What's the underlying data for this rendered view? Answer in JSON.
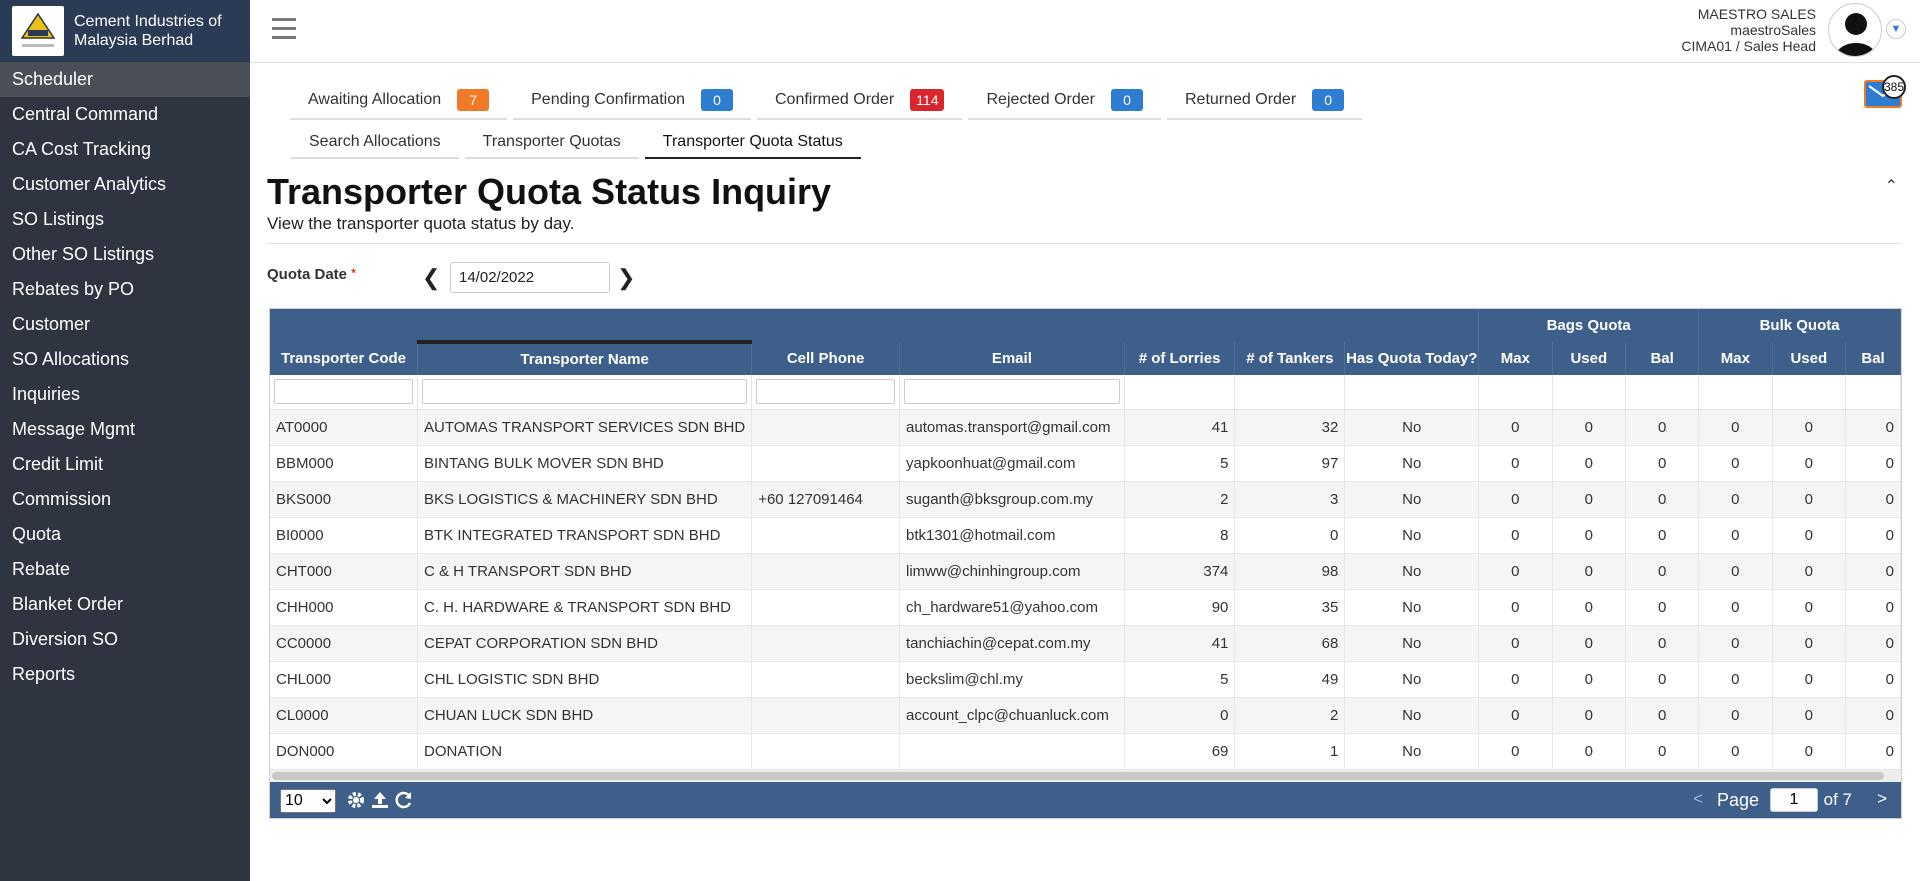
{
  "brand": {
    "name_line1": "Cement Industries of",
    "name_line2": "Malaysia Berhad"
  },
  "sidebar": {
    "items": [
      {
        "label": "Scheduler",
        "active": true
      },
      {
        "label": "Central Command"
      },
      {
        "label": "CA Cost Tracking"
      },
      {
        "label": "Customer Analytics"
      },
      {
        "label": "SO Listings"
      },
      {
        "label": "Other SO Listings"
      },
      {
        "label": "Rebates by PO"
      },
      {
        "label": "Customer"
      },
      {
        "label": "SO Allocations"
      },
      {
        "label": "Inquiries"
      },
      {
        "label": "Message Mgmt"
      },
      {
        "label": "Credit Limit"
      },
      {
        "label": "Commission"
      },
      {
        "label": "Quota"
      },
      {
        "label": "Rebate"
      },
      {
        "label": "Blanket Order"
      },
      {
        "label": "Diversion SO"
      },
      {
        "label": "Reports"
      }
    ]
  },
  "user": {
    "name": "MAESTRO SALES",
    "username": "maestroSales",
    "role": "CIMA01 / Sales Head"
  },
  "notifications": {
    "count": "385"
  },
  "status_tabs": [
    {
      "label": "Awaiting Allocation",
      "count": "7",
      "color": "#f07a28"
    },
    {
      "label": "Pending Confirmation",
      "count": "0",
      "color": "#2e7dd1"
    },
    {
      "label": "Confirmed Order",
      "count": "114",
      "color": "#d9262c"
    },
    {
      "label": "Rejected Order",
      "count": "0",
      "color": "#2e7dd1"
    },
    {
      "label": "Returned Order",
      "count": "0",
      "color": "#2e7dd1"
    }
  ],
  "sub_tabs": [
    {
      "label": "Search Allocations"
    },
    {
      "label": "Transporter Quotas"
    },
    {
      "label": "Transporter Quota Status",
      "active": true
    }
  ],
  "page": {
    "title": "Transporter Quota Status Inquiry",
    "subtitle": "View the transporter quota status by day."
  },
  "filter": {
    "label": "Quota Date",
    "required_mark": "*",
    "value": "14/02/2022"
  },
  "grid": {
    "group_headers": {
      "bags": "Bags Quota",
      "bulk": "Bulk Quota"
    },
    "columns": {
      "code": "Transporter Code",
      "name": "Transporter Name",
      "phone": "Cell Phone",
      "email": "Email",
      "lorries": "# of Lorries",
      "tankers": "# of Tankers",
      "has_quota": "Has Quota Today?",
      "bags_max": "Max",
      "bags_used": "Used",
      "bags_bal": "Bal",
      "bulk_max": "Max",
      "bulk_used": "Used",
      "bulk_bal": "Bal"
    },
    "rows": [
      {
        "code": "AT0000",
        "name": "AUTOMAS TRANSPORT SERVICES SDN BHD",
        "phone": "",
        "email": "automas.transport@gmail.com",
        "lorries": "41",
        "tankers": "32",
        "has_quota": "No",
        "bags_max": "0",
        "bags_used": "0",
        "bags_bal": "0",
        "bulk_max": "0",
        "bulk_used": "0",
        "bulk_bal": "0"
      },
      {
        "code": "BBM000",
        "name": "BINTANG BULK MOVER SDN BHD",
        "phone": "",
        "email": "yapkoonhuat@gmail.com",
        "lorries": "5",
        "tankers": "97",
        "has_quota": "No",
        "bags_max": "0",
        "bags_used": "0",
        "bags_bal": "0",
        "bulk_max": "0",
        "bulk_used": "0",
        "bulk_bal": "0"
      },
      {
        "code": "BKS000",
        "name": "BKS LOGISTICS & MACHINERY SDN BHD",
        "phone": "+60 127091464",
        "email": "suganth@bksgroup.com.my",
        "lorries": "2",
        "tankers": "3",
        "has_quota": "No",
        "bags_max": "0",
        "bags_used": "0",
        "bags_bal": "0",
        "bulk_max": "0",
        "bulk_used": "0",
        "bulk_bal": "0"
      },
      {
        "code": "BI0000",
        "name": "BTK INTEGRATED TRANSPORT SDN BHD",
        "phone": "",
        "email": "btk1301@hotmail.com",
        "lorries": "8",
        "tankers": "0",
        "has_quota": "No",
        "bags_max": "0",
        "bags_used": "0",
        "bags_bal": "0",
        "bulk_max": "0",
        "bulk_used": "0",
        "bulk_bal": "0"
      },
      {
        "code": "CHT000",
        "name": "C & H TRANSPORT SDN BHD",
        "phone": "",
        "email": "limww@chinhingroup.com",
        "lorries": "374",
        "tankers": "98",
        "has_quota": "No",
        "bags_max": "0",
        "bags_used": "0",
        "bags_bal": "0",
        "bulk_max": "0",
        "bulk_used": "0",
        "bulk_bal": "0"
      },
      {
        "code": "CHH000",
        "name": "C. H. HARDWARE & TRANSPORT SDN BHD",
        "phone": "",
        "email": "ch_hardware51@yahoo.com",
        "lorries": "90",
        "tankers": "35",
        "has_quota": "No",
        "bags_max": "0",
        "bags_used": "0",
        "bags_bal": "0",
        "bulk_max": "0",
        "bulk_used": "0",
        "bulk_bal": "0"
      },
      {
        "code": "CC0000",
        "name": "CEPAT CORPORATION SDN BHD",
        "phone": "",
        "email": "tanchiachin@cepat.com.my",
        "lorries": "41",
        "tankers": "68",
        "has_quota": "No",
        "bags_max": "0",
        "bags_used": "0",
        "bags_bal": "0",
        "bulk_max": "0",
        "bulk_used": "0",
        "bulk_bal": "0"
      },
      {
        "code": "CHL000",
        "name": "CHL LOGISTIC SDN BHD",
        "phone": "",
        "email": "beckslim@chl.my",
        "lorries": "5",
        "tankers": "49",
        "has_quota": "No",
        "bags_max": "0",
        "bags_used": "0",
        "bags_bal": "0",
        "bulk_max": "0",
        "bulk_used": "0",
        "bulk_bal": "0"
      },
      {
        "code": "CL0000",
        "name": "CHUAN LUCK SDN BHD",
        "phone": "",
        "email": "account_clpc@chuanluck.com",
        "lorries": "0",
        "tankers": "2",
        "has_quota": "No",
        "bags_max": "0",
        "bags_used": "0",
        "bags_bal": "0",
        "bulk_max": "0",
        "bulk_used": "0",
        "bulk_bal": "0"
      },
      {
        "code": "DON000",
        "name": "DONATION",
        "phone": "",
        "email": "",
        "lorries": "69",
        "tankers": "1",
        "has_quota": "No",
        "bags_max": "0",
        "bags_used": "0",
        "bags_bal": "0",
        "bulk_max": "0",
        "bulk_used": "0",
        "bulk_bal": "0"
      }
    ]
  },
  "pager": {
    "page_size": "10",
    "page_label": "Page",
    "current_page": "1",
    "of_label": "of 7",
    "prev": "<",
    "next": ">"
  },
  "icons": {
    "menu": "hamburger-icon",
    "mail": "mail-icon",
    "settings": "gear-icon",
    "export": "upload-icon",
    "refresh": "refresh-icon",
    "collapse": "chevron-up-icon"
  }
}
